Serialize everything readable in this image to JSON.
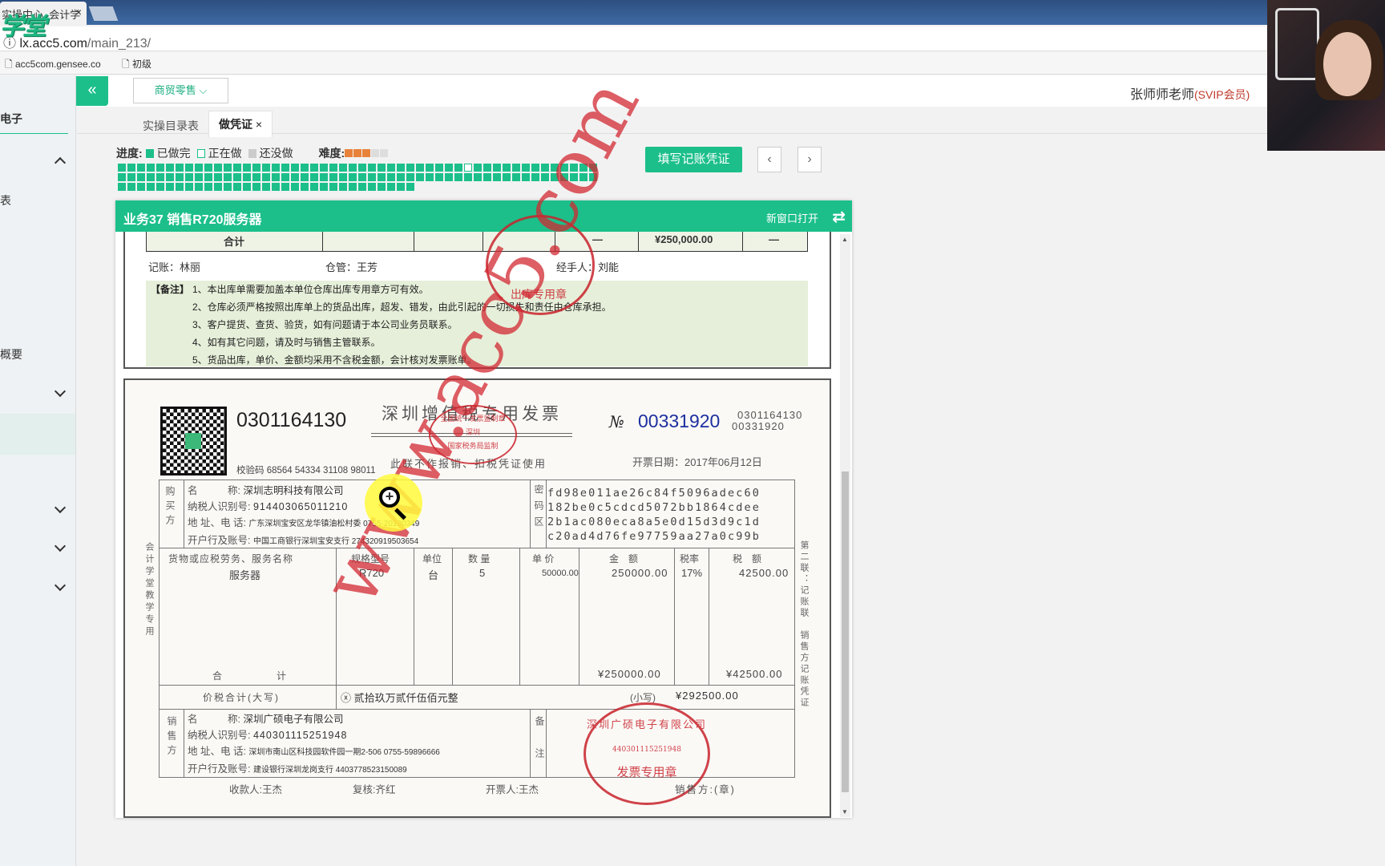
{
  "browser": {
    "tab_title": "实操中心_会计学",
    "tab_close": "×",
    "url_host": "lx.acc5.com",
    "url_path": "/main_213/",
    "bookmarks": [
      "acc5com.gensee.co",
      "初级"
    ]
  },
  "logo_text": "学堂",
  "sidebar": {
    "items": [
      {
        "label": "电子"
      },
      {
        "label": "表"
      },
      {
        "label": "概要"
      }
    ]
  },
  "header": {
    "collapse_icon": "«",
    "industry_select": "商贸零售",
    "user_name": "张师师老师",
    "user_badge": "(SVIP会员)"
  },
  "tabs": [
    {
      "label": "实操目录表",
      "active": false
    },
    {
      "label": "做凭证",
      "active": true,
      "close": "×"
    }
  ],
  "progress": {
    "label": "进度:",
    "legend_done": "已做完",
    "legend_doing": "正在做",
    "legend_todo": "还没做",
    "difficulty_label": "难度:",
    "difficulty": 3,
    "difficulty_max": 5,
    "total_tasks": 131,
    "current_task": 37,
    "colors": {
      "done": "#1cbf8a",
      "doing": "#ffffff",
      "todo": "#cccccc",
      "star": "#e8823a"
    }
  },
  "actions": {
    "fill_voucher": "填写记账凭证",
    "prev": "‹",
    "next": "›"
  },
  "panel": {
    "title": "业务37 销售R720服务器",
    "open_new_window": "新窗口打开",
    "swap_icon": "⇄"
  },
  "outbound_form": {
    "total_label": "合计",
    "dash1": "—",
    "total_amount": "¥250,000.00",
    "dash2": "—",
    "bookkeeper": "记账：林丽",
    "warehouse_keeper": "仓管：王芳",
    "handler": "经手人：刘能",
    "notes_label": "【备注】",
    "notes": [
      "1、本出库单需要加盖本单位仓库出库专用章方可有效。",
      "2、仓库必须严格按照出库单上的货品出库，超发、错发，由此引起的一切损失和责任由仓库承担。",
      "3、客户提货、查货、验货，如有问题请于本公司业务员联系。",
      "4、如有其它问题，请及时与销售主管联系。",
      "5、货品出库，单价、金额均采用不含税金额，会计核对发票账单。"
    ],
    "stamp_text": "出库专用章"
  },
  "invoice": {
    "code": "0301164130",
    "title": "深圳增值税专用发票",
    "subtitle": "此联不作报销、扣税凭证使用",
    "check_code": "校验码 68564 54334 31108 98011",
    "no_label": "№",
    "number": "00331920",
    "small_code": "0301164130",
    "small_number": "00331920",
    "date": "开票日期：2017年06月12日",
    "header_stamp": [
      "全国统一发票监制章",
      "深圳",
      "国家税务局监制"
    ],
    "buyer": {
      "section": "购买方",
      "name_label": "名　　　称:",
      "name": "深圳志明科技有限公司",
      "tax_id_label": "纳税人识别号:",
      "tax_id": "914403065011210",
      "address_label": "地 址、电 话:",
      "address": "广东深圳宝安区龙华镇油松村委 0755-20130349",
      "bank_label": "开户行及账号:",
      "bank": "中国工商银行深圳宝安支行 274320919503654"
    },
    "cipher_label": "密码区",
    "cipher": [
      "fd98e011ae26c84f5096adec60",
      "182be0c5cdcd5072bb1864cdee",
      "2b1ac080eca8a5e0d15d3d9c1d",
      "c20ad4d76fe97759aa27a0c99b"
    ],
    "columns": [
      "货物或应税劳务、服务名称",
      "规格型号",
      "单位",
      "数 量",
      "单 价",
      "金　额",
      "税率",
      "税　额"
    ],
    "items": [
      {
        "name": "服务器",
        "model": "R720",
        "unit": "台",
        "qty": "5",
        "price": "50000.00",
        "amount": "250000.00",
        "rate": "17%",
        "tax": "42500.00"
      }
    ],
    "total_label": "合　　　计",
    "total_amount": "¥250000.00",
    "total_tax": "¥42500.00",
    "grand_label": "价税合计(大写)",
    "grand_words": "ⓧ 贰拾玖万贰仟伍佰元整",
    "grand_small_label": "(小写)",
    "grand_small": "¥292500.00",
    "seller": {
      "section": "销售方",
      "name_label": "名　　　称:",
      "name": "深圳广硕电子有限公司",
      "tax_id_label": "纳税人识别号:",
      "tax_id": "440301115251948",
      "address_label": "地 址、电 话:",
      "address": "深圳市南山区科技园软件园一期2-506 0755-59896666",
      "bank_label": "开户行及账号:",
      "bank": "建设银行深圳龙岗支行 4403778523150089"
    },
    "remarks_label": "备注",
    "seller_stamp": [
      "深圳广硕电子有限公司",
      "440301115251948",
      "发票专用章"
    ],
    "payee": "收款人:王杰",
    "reviewer": "复核:齐红",
    "issuer": "开票人:王杰",
    "seller_sign": "销售方:(章)",
    "left_vertical": "会计学堂教学专用",
    "right_vertical": "第二联：记账联　销售方记账凭证",
    "watermark": "www.acc5.com"
  }
}
